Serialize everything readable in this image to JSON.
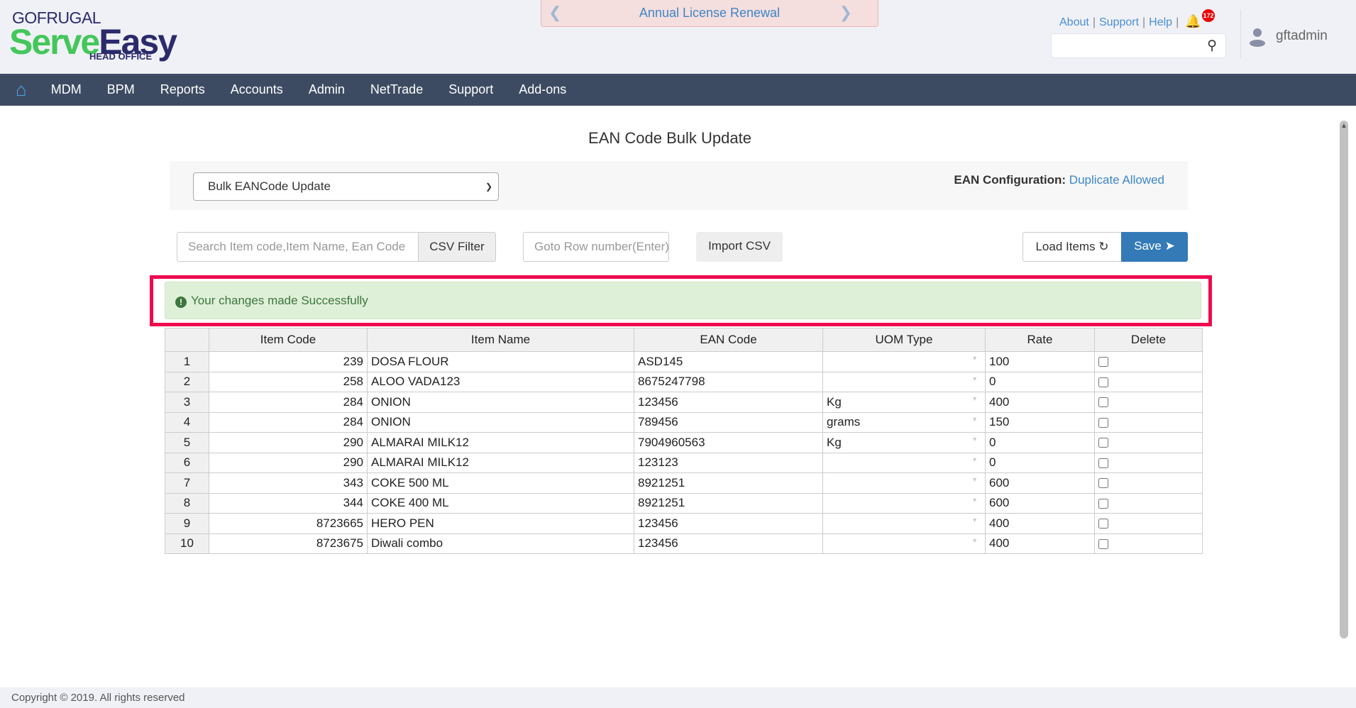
{
  "header": {
    "logo_top": "GOFRUGAL",
    "logo_serve": "Serve",
    "logo_easy": "Easy",
    "logo_sub": "HEAD OFFICE",
    "banner": "Annual License Renewal",
    "links": [
      "About",
      "Support",
      "Help"
    ],
    "notification_count": "172",
    "username": "gftadmin"
  },
  "nav": [
    "MDM",
    "BPM",
    "Reports",
    "Accounts",
    "Admin",
    "NetTrade",
    "Support",
    "Add-ons"
  ],
  "page": {
    "title": "EAN Code Bulk Update",
    "select_value": "Bulk EANCode Update",
    "ean_config_label": "EAN Configuration:",
    "ean_config_value": "Duplicate Allowed"
  },
  "toolbar": {
    "search_placeholder": "Search Item code,Item Name, Ean Code",
    "csv_filter": "CSV Filter",
    "goto_placeholder": "Goto Row number(Enter)",
    "import_csv": "Import CSV",
    "load_items": "Load Items",
    "save": "Save"
  },
  "alert": "Your changes made Successfully",
  "table": {
    "headers": [
      "",
      "Item Code",
      "Item Name",
      "EAN Code",
      "UOM Type",
      "Rate",
      "Delete"
    ],
    "rows": [
      {
        "n": "1",
        "code": "239",
        "name": "DOSA FLOUR",
        "ean": "ASD145",
        "uom": "",
        "rate": "100"
      },
      {
        "n": "2",
        "code": "258",
        "name": "ALOO VADA123",
        "ean": "8675247798",
        "uom": "",
        "rate": "0"
      },
      {
        "n": "3",
        "code": "284",
        "name": "ONION",
        "ean": "123456",
        "uom": "Kg",
        "rate": "400"
      },
      {
        "n": "4",
        "code": "284",
        "name": "ONION",
        "ean": "789456",
        "uom": "grams",
        "rate": "150"
      },
      {
        "n": "5",
        "code": "290",
        "name": "ALMARAI MILK12",
        "ean": "7904960563",
        "uom": "Kg",
        "rate": "0"
      },
      {
        "n": "6",
        "code": "290",
        "name": "ALMARAI MILK12",
        "ean": "123123",
        "uom": "",
        "rate": "0"
      },
      {
        "n": "7",
        "code": "343",
        "name": "COKE 500 ML",
        "ean": "8921251",
        "uom": "",
        "rate": "600"
      },
      {
        "n": "8",
        "code": "344",
        "name": "COKE 400 ML",
        "ean": "8921251",
        "uom": "",
        "rate": "600"
      },
      {
        "n": "9",
        "code": "8723665",
        "name": "HERO PEN",
        "ean": "123456",
        "uom": "",
        "rate": "400"
      },
      {
        "n": "10",
        "code": "8723675",
        "name": "Diwali combo",
        "ean": "123456",
        "uom": "",
        "rate": "400"
      }
    ]
  },
  "footer": "Copyright © 2019. All rights reserved"
}
